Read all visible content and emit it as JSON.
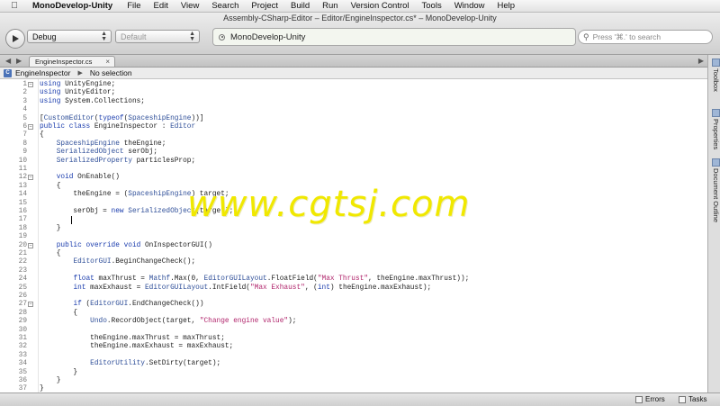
{
  "menubar": {
    "apple_icon": "apple-icon",
    "app_name": "MonoDevelop-Unity",
    "items": [
      "File",
      "Edit",
      "View",
      "Search",
      "Project",
      "Build",
      "Run",
      "Version Control",
      "Tools",
      "Window",
      "Help"
    ]
  },
  "window": {
    "title": "Assembly-CSharp-Editor – Editor/EngineInspector.cs* – MonoDevelop-Unity"
  },
  "toolbar": {
    "config_value": "Debug",
    "platform_value": "Default",
    "status_text": "MonoDevelop-Unity",
    "search_placeholder": "Press '⌘.' to search"
  },
  "tabs": [
    {
      "label": "EngineInspector.cs"
    }
  ],
  "pathbar": {
    "class_name": "EngineInspector",
    "member": "No selection"
  },
  "editor": {
    "lines": [
      "using UnityEngine;",
      "using UnityEditor;",
      "using System.Collections;",
      "",
      "[CustomEditor(typeof(SpaceshipEngine))]",
      "public class EngineInspector : Editor",
      "{",
      "    SpaceshipEngine theEngine;",
      "    SerializedObject serObj;",
      "    SerializedProperty particlesProp;",
      "",
      "    void OnEnable()",
      "    {",
      "        theEngine = (SpaceshipEngine) target;",
      "",
      "        serObj = new SerializedObject(target);",
      "        ",
      "    }",
      "",
      "    public override void OnInspectorGUI()",
      "    {",
      "        EditorGUI.BeginChangeCheck();",
      "",
      "        float maxThrust = Mathf.Max(0, EditorGUILayout.FloatField(\"Max Thrust\", theEngine.maxThrust));",
      "        int maxExhaust = EditorGUILayout.IntField(\"Max Exhaust\", (int) theEngine.maxExhaust);",
      "",
      "        if (EditorGUI.EndChangeCheck())",
      "        {",
      "            Undo.RecordObject(target, \"Change engine value\");",
      "",
      "            theEngine.maxThrust = maxThrust;",
      "            theEngine.maxExhaust = maxExhaust;",
      "",
      "            EditorUtility.SetDirty(target);",
      "        }",
      "    }",
      "}"
    ],
    "fold_lines": [
      1,
      6,
      12,
      20,
      27
    ],
    "cursor_line": 17
  },
  "watermark": "www.cgtsj.com",
  "dock": {
    "tabs": [
      "Toolbox",
      "Properties",
      "Document Outline"
    ]
  },
  "statusbar": {
    "errors_label": "Errors",
    "tasks_label": "Tasks"
  }
}
